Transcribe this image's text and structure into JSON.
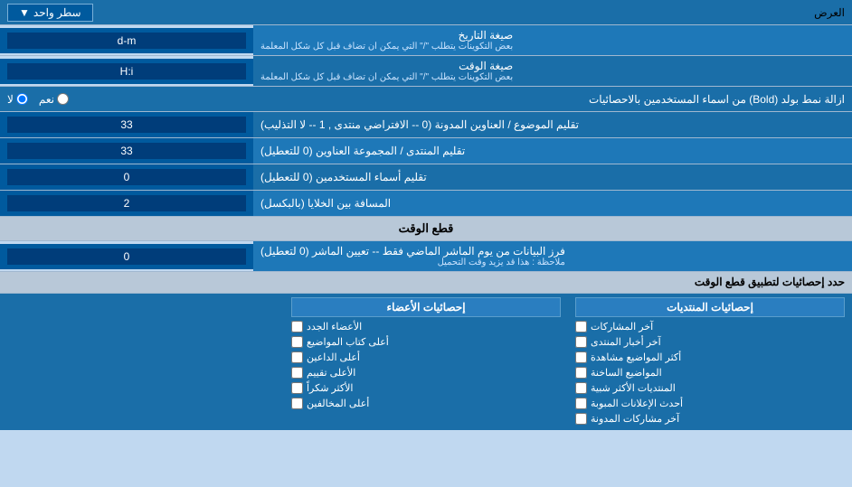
{
  "header": {
    "label": "العرض",
    "dropdown_label": "سطر واحد",
    "dropdown_arrow": "▼"
  },
  "rows": [
    {
      "id": "date-format",
      "label": "صيغة التاريخ",
      "sublabel": "بعض التكوينات يتطلب \"/\" التي يمكن ان تضاف قبل كل شكل المعلمة",
      "value": "d-m"
    },
    {
      "id": "time-format",
      "label": "صيغة الوقت",
      "sublabel": "بعض التكوينات يتطلب \"/\" التي يمكن ان تضاف قبل كل شكل المعلمة",
      "value": "H:i"
    },
    {
      "id": "bold-remove",
      "label": "ازالة نمط بولد (Bold) من اسماء المستخدمين بالاحصائيات",
      "radio_yes": "نعم",
      "radio_no": "لا",
      "selected": "no"
    },
    {
      "id": "subject-order",
      "label": "تقليم الموضوع / العناوين المدونة (0 -- الافتراضي منتدى , 1 -- لا التذليب)",
      "value": "33"
    },
    {
      "id": "forum-order",
      "label": "تقليم المنتدى / المجموعة العناوين (0 للتعطيل)",
      "value": "33"
    },
    {
      "id": "user-names",
      "label": "تقليم أسماء المستخدمين (0 للتعطيل)",
      "value": "0"
    },
    {
      "id": "space-between",
      "label": "المسافة بين الخلايا (بالبكسل)",
      "value": "2"
    }
  ],
  "time_cut_section": {
    "title": "قطع الوقت",
    "row_label": "فرز البيانات من يوم الماشر الماضي فقط -- تعيين الماشر (0 لتعطيل)",
    "note_label": "ملاحظة : هذا قد يزيد وقت التحميل",
    "value": "0"
  },
  "stats_section": {
    "header": "حدد إحصائيات لتطبيق قطع الوقت",
    "col1": {
      "title": "إحصائيات المنتديات",
      "items": [
        "آخر المشاركات",
        "آخر أخبار المنتدى",
        "أكثر المواضيع مشاهدة",
        "المواضيع الساخنة",
        "المنتديات الأكثر شبية",
        "أحدث الإعلانات المبوبة",
        "آخر مشاركات المدونة"
      ]
    },
    "col2": {
      "title": "إحصائيات الأعضاء",
      "items": [
        "الأعضاء الجدد",
        "أعلى كتاب المواضيع",
        "أعلى الداعين",
        "الأعلى تقييم",
        "الأكثر شكراً",
        "أعلى المخالفين"
      ]
    }
  }
}
